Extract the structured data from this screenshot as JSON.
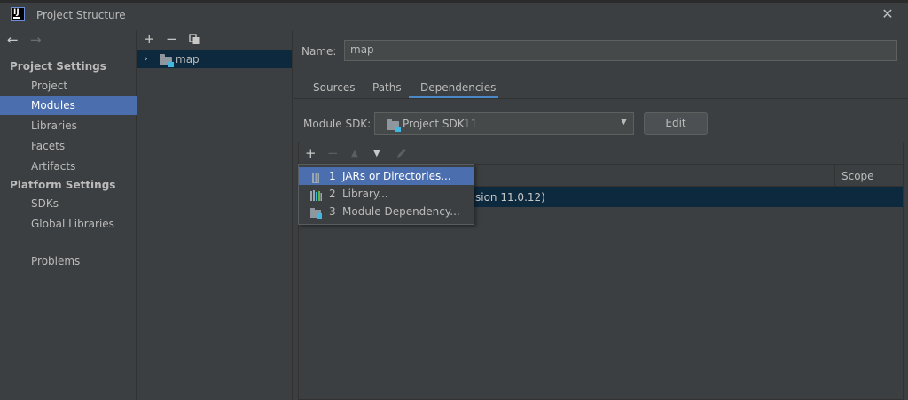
{
  "window": {
    "title": "Project Structure"
  },
  "sidebar": {
    "sections": [
      {
        "header": "Project Settings",
        "items": [
          "Project",
          "Modules",
          "Libraries",
          "Facets",
          "Artifacts"
        ]
      },
      {
        "header": "Platform Settings",
        "items": [
          "SDKs",
          "Global Libraries"
        ]
      }
    ],
    "extra_item": "Problems",
    "selected": "Modules"
  },
  "tree": {
    "module_name": "map"
  },
  "module": {
    "name_label": "Name:",
    "name_value": "map",
    "tabs": [
      "Sources",
      "Paths",
      "Dependencies"
    ],
    "active_tab": "Dependencies",
    "sdk_label": "Module SDK:",
    "sdk_value": "Project SDK",
    "sdk_version": "11",
    "edit_label": "Edit"
  },
  "dependencies": {
    "scope_header": "Scope",
    "row_text_fragment": "sion 11.0.12)"
  },
  "add_menu": {
    "items": [
      {
        "num": "1",
        "label": "JARs or Directories...",
        "icon": "jar-icon",
        "active": true
      },
      {
        "num": "2",
        "label": "Library...",
        "icon": "library-icon",
        "active": false
      },
      {
        "num": "3",
        "label": "Module Dependency...",
        "icon": "module-icon",
        "active": false
      }
    ]
  },
  "colors": {
    "accent": "#4b6eaf",
    "selection_dark": "#0d293e",
    "tab_underline": "#4a88c7"
  }
}
